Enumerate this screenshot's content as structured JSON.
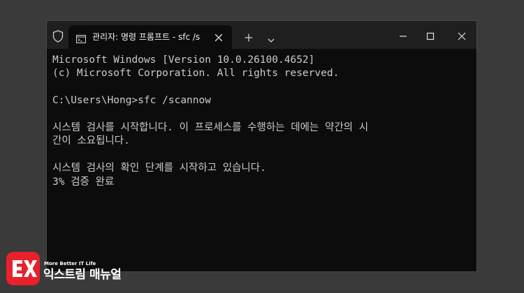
{
  "window": {
    "tab_title": "관리자: 명령 프롬프트 - sfc /s"
  },
  "icons": {
    "shield": "shield-icon",
    "terminal": "terminal-icon",
    "close_tab": "close-icon",
    "new_tab": "plus-icon",
    "dropdown": "chevron-down-icon",
    "minimize": "minimize-icon",
    "maximize": "maximize-icon",
    "close_window": "close-icon"
  },
  "console": {
    "lines": [
      "Microsoft Windows [Version 10.0.26100.4652]",
      "(c) Microsoft Corporation. All rights reserved.",
      "",
      "C:\\Users\\Hong>sfc /scannow",
      "",
      "시스템 검사를 시작합니다. 이 프로세스를 수행하는 데에는 약간의 시",
      "간이 소요됩니다.",
      "",
      "시스템 검사의 확인 단계를 시작하고 있습니다.",
      "3% 검증 완료"
    ]
  },
  "brand": {
    "tagline": "More Better IT Life",
    "name": "익스트림 매뉴얼"
  },
  "colors": {
    "page_background": "#3a3a3a",
    "titlebar": "#1f1f1f",
    "console_background": "#0c0c0c",
    "console_text": "#cccccc",
    "logo_red": "#e8212b"
  }
}
